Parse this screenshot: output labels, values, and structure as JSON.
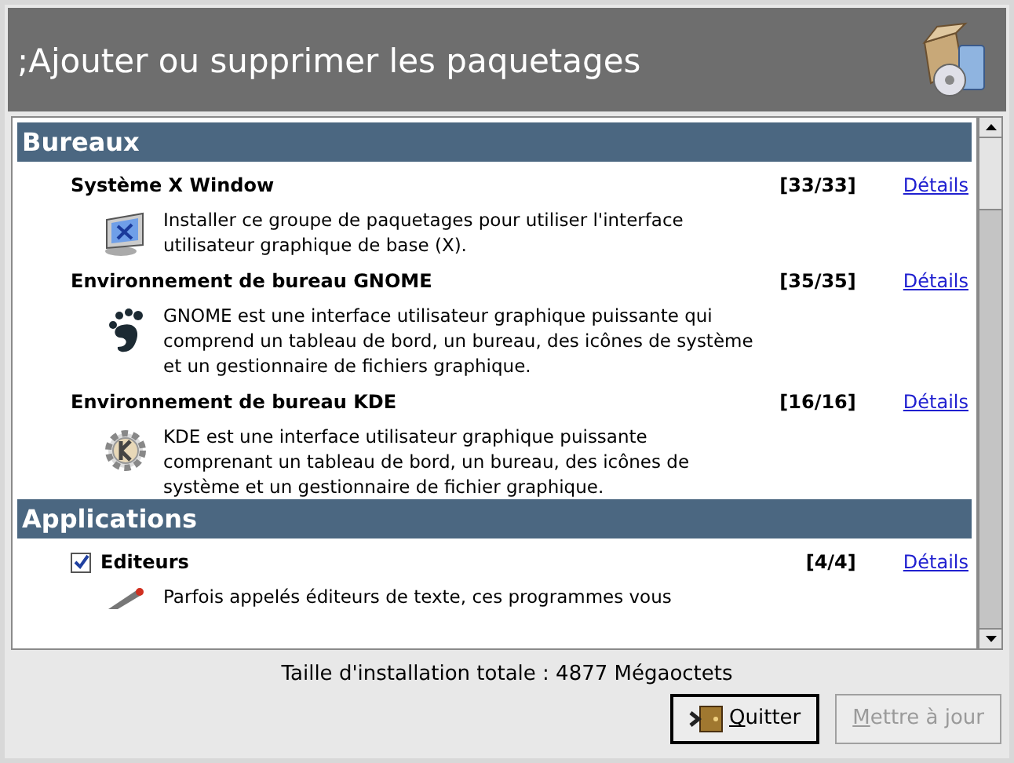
{
  "window": {
    "title": ";Ajouter ou supprimer les paquetages"
  },
  "sections": [
    {
      "title": "Bureaux",
      "items": [
        {
          "kind": "group",
          "name": "Système X Window",
          "count": "[33/33]",
          "link": "Détails",
          "description": "Installer ce groupe de paquetages pour utiliser l'interface utilisateur graphique de base (X)."
        },
        {
          "kind": "group",
          "name": "Environnement de bureau GNOME",
          "count": "[35/35]",
          "link": "Détails",
          "description": "GNOME est une interface utilisateur graphique puissante qui comprend un tableau de bord, un bureau, des icônes de système et un gestionnaire de fichiers graphique."
        },
        {
          "kind": "group",
          "name": "Environnement de bureau KDE",
          "count": "[16/16]",
          "link": "Détails",
          "description": "KDE est une interface utilisateur graphique puissante comprenant un tableau de bord, un bureau, des icônes de système et un gestionnaire de fichier graphique."
        }
      ]
    },
    {
      "title": "Applications",
      "items": [
        {
          "kind": "checkbox",
          "checked": true,
          "name": "Editeurs",
          "count": "[4/4]",
          "link": "Détails",
          "description": "Parfois appelés éditeurs de texte, ces programmes vous"
        }
      ]
    }
  ],
  "status": "Taille d'installation totale : 4877 Mégaoctets",
  "buttons": [
    {
      "label": "Quitter",
      "disabled": false
    },
    {
      "label": "Mettre à jour",
      "disabled": true
    }
  ]
}
